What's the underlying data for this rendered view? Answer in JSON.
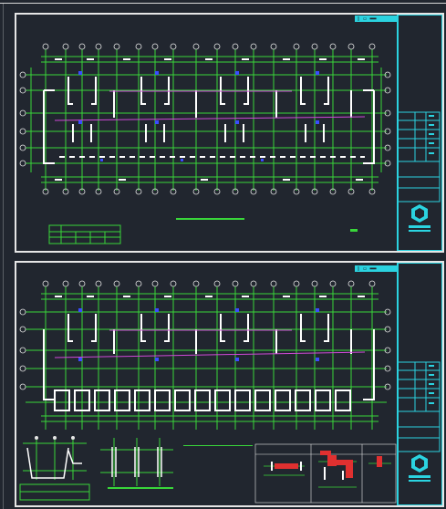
{
  "app": {
    "background_color": "#21262f",
    "frame_color": "#e6e6e6",
    "grid_color": "#39d63a",
    "wall_color": "#ffffff",
    "titleblock_color": "#2bd3e0",
    "accent_magenta": "#d04ad8",
    "accent_blue": "#3a4cff",
    "accent_red": "#e03030"
  },
  "sheets": [
    {
      "id": "sheet-1",
      "tag_text": "▯ ▭ ▬▬",
      "icon": "logo-hexagon-icon"
    },
    {
      "id": "sheet-2",
      "tag_text": "▯ ▭ ▬▬",
      "icon": "logo-hexagon-icon"
    }
  ]
}
